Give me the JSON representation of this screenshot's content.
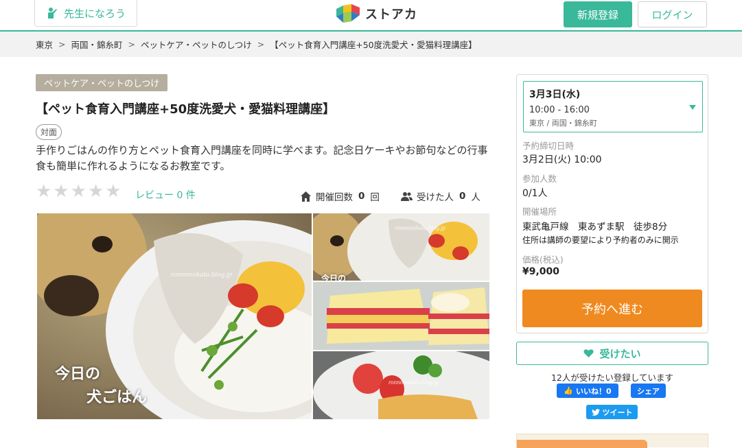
{
  "header": {
    "teach_label": "先生になろう",
    "logo_text": "ストアカ",
    "signup_label": "新規登録",
    "login_label": "ログイン",
    "brand_color": "#39b89a"
  },
  "breadcrumb": [
    "東京",
    "両国・錦糸町",
    "ペットケア・ペットのしつけ",
    "【ペット食育入門講座+50度洗愛犬・愛猫料理講座】"
  ],
  "breadcrumb_separator": ">",
  "lesson": {
    "category": "ペットケア・ペットのしつけ",
    "title": "【ペット食育入門講座+50度洗愛犬・愛猫料理講座】",
    "mode": "対面",
    "description": "手作りごはんの作り方とペット食育入門講座を同時に学べます。記念日ケーキやお節句などの行事食も簡単に作れるようになるお教室です。",
    "rating_stars": 0,
    "review_label": "レビュー 0 件",
    "held_label": "開催回数",
    "held_count": "0",
    "held_unit": "回",
    "attendees_label": "受けた人",
    "attendees_count": "0",
    "attendees_unit": "人"
  },
  "photos": {
    "main_caption_line1": "今日の",
    "main_caption_line2": "犬ごはん",
    "main_watermark": "ronnnookala.blog.jp",
    "thumb1_watermark": "ronnnookala.blog.jp",
    "thumb1_caption": "今日の",
    "thumb3_watermark": "ronnnookala.blog.jp"
  },
  "sidebar": {
    "date": "3月3日(水)",
    "time": "10:00 - 16:00",
    "place": "東京 / 両国・錦糸町",
    "deadline_label": "予約締切日時",
    "deadline_value": "3月2日(火) 10:00",
    "participants_label": "参加人数",
    "participants_value": "0/1人",
    "venue_label": "開催場所",
    "venue_value": "東武亀戸線　東あずま駅　徒歩8分",
    "venue_note": "住所は講師の要望により予約者のみに開示",
    "price_label": "価格(税込)",
    "price_value": "¥9,000",
    "reserve_label": "予約へ進む",
    "reserve_color": "#ef8a20"
  },
  "social": {
    "want_label": "受けたい",
    "want_count_text": "12人が受けたい登録しています",
    "like_label": "いいね！0",
    "share_label": "シェア",
    "tweet_label": "ツイート"
  }
}
